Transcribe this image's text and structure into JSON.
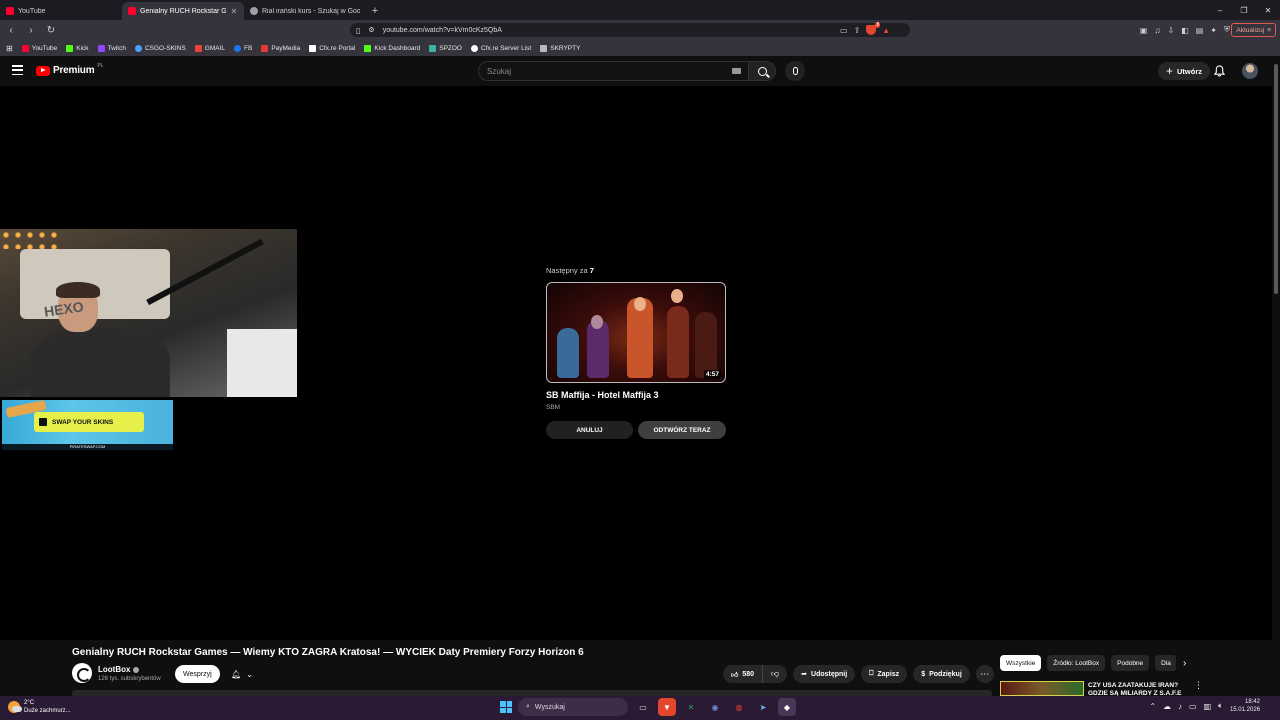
{
  "browser": {
    "tabs": [
      {
        "title": "YouTube",
        "favicon_color": "#ff0033",
        "active": false
      },
      {
        "title": "Genialny RUCH Rockstar Games",
        "favicon_color": "#ff0033",
        "active": true
      },
      {
        "title": "Rial irański kurs - Szukaj w Google",
        "favicon_color": "#9aa0a6",
        "active": false
      }
    ],
    "url": "youtube.com/watch?v=kVm0cKz5QbA",
    "update_label": "Aktualizuj",
    "shield_count": "8",
    "bookmarks": [
      {
        "label": "YouTube",
        "color": "#ff0033"
      },
      {
        "label": "Kick",
        "color": "#53fc18"
      },
      {
        "label": "Twitch",
        "color": "#9146ff"
      },
      {
        "label": "CSGO-SKINS",
        "color": "#4aa3ff"
      },
      {
        "label": "GMAIL",
        "color": "#ea4335"
      },
      {
        "label": "FB",
        "color": "#1877f2"
      },
      {
        "label": "PayMedia",
        "color": "#e53935"
      },
      {
        "label": "Cfx.re Portal",
        "color": "#ffffff"
      },
      {
        "label": "Kick Dashboard",
        "color": "#53fc18"
      },
      {
        "label": "SPZOO",
        "color": "#3bb2a6"
      },
      {
        "label": "Cfx.re Server List",
        "color": "#ffffff"
      },
      {
        "label": "SKRYPTY",
        "color": "#bbbbbb"
      }
    ]
  },
  "youtube": {
    "logo_text": "Premium",
    "country": "PL",
    "search_placeholder": "Szukaj",
    "create_label": "Utwórz"
  },
  "player": {
    "shirt_text": "HEXO",
    "banner_text": "SWAP YOUR SKINS",
    "banner_sub": "PIRATESWAP.COM",
    "upnext": {
      "label_prefix": "Następny za",
      "countdown": "7",
      "title": "SB Maffija - Hotel Maffija 3",
      "channel": "SBM",
      "duration": "4:57",
      "cancel_label": "ANULUJ",
      "play_label": "ODTWÓRZ TERAZ"
    }
  },
  "video": {
    "title": "Genialny RUCH Rockstar Games — Wiemy KTO ZAGRA Kratosa! — WYCIEK Daty Premiery Forzy Horizon 6",
    "channel": "LootBox",
    "subscribers": "126 tys. subskrybentów",
    "join_label": "Wesprzyj",
    "likes": "580",
    "share_label": "Udostępnij",
    "save_label": "Zapisz",
    "thanks_label": "Podziękuj"
  },
  "sidebar": {
    "chips": [
      "Wszystkie",
      "Źródło: LootBox",
      "Podobne",
      "Dla"
    ],
    "rec_title": "CZY USA ZAATAKUJE IRAN? GDZIE SĄ MILIARDY Z S.A.F.E"
  },
  "taskbar": {
    "temp": "2°C",
    "weather": "Duże zachmurz...",
    "search_label": "Wyszukaj",
    "time": "18:42",
    "date": "15.01.2026"
  }
}
